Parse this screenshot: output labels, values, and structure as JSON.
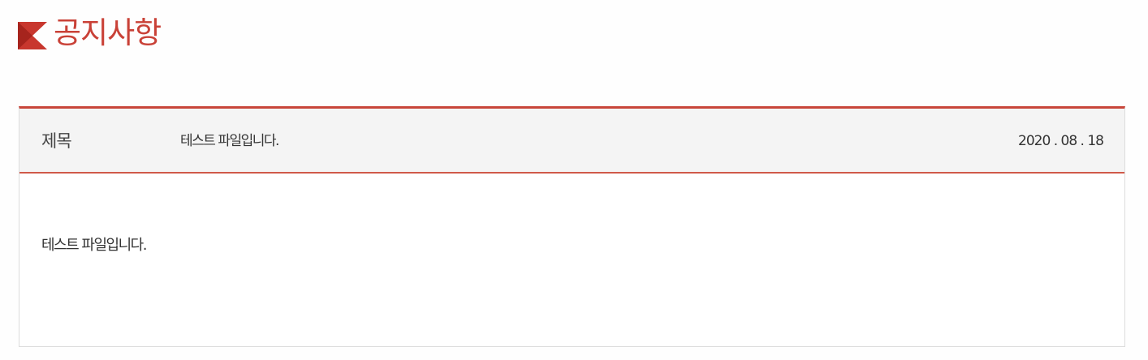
{
  "header": {
    "title": "공지사항",
    "icon": "red-flag-icon",
    "accent_color": "#c94137"
  },
  "notice": {
    "subject_label": "제목",
    "subject": "테스트 파일입니다.",
    "date": "2020 . 08 . 18",
    "content": "테스트 파일입니다."
  }
}
